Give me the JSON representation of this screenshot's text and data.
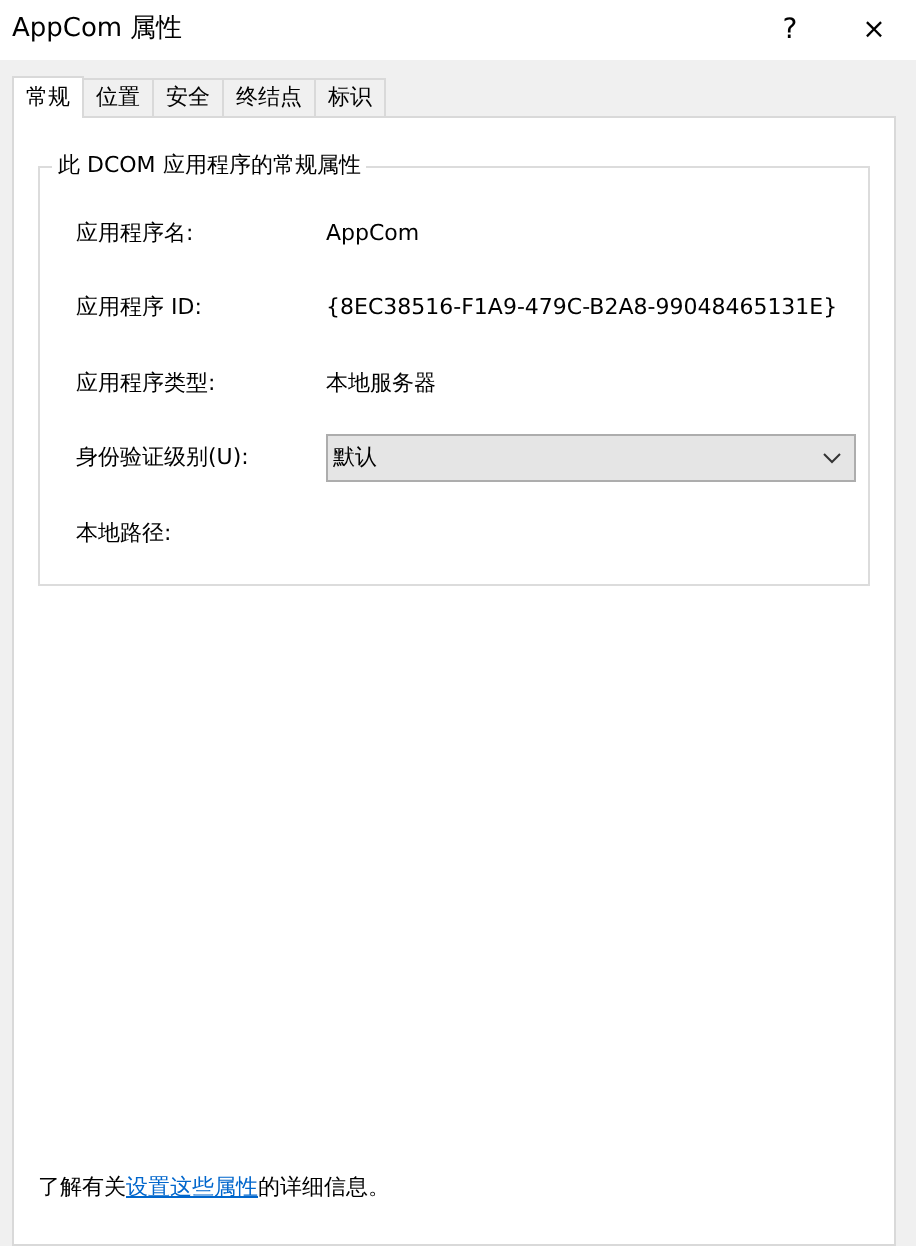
{
  "window": {
    "title": "AppCom 属性",
    "help": "?",
    "close": "×"
  },
  "tabs": [
    {
      "label": "常规",
      "selected": true
    },
    {
      "label": "位置",
      "selected": false
    },
    {
      "label": "安全",
      "selected": false
    },
    {
      "label": "终结点",
      "selected": false
    },
    {
      "label": "标识",
      "selected": false
    }
  ],
  "group": {
    "title": "此 DCOM 应用程序的常规属性",
    "fields": [
      {
        "kind": "text",
        "label": "应用程序名:",
        "value": "AppCom"
      },
      {
        "kind": "text",
        "label": "应用程序 ID:",
        "value": "{8EC38516-F1A9-479C-B2A8-99048465131E}"
      },
      {
        "kind": "text",
        "label": "应用程序类型:",
        "value": "本地服务器"
      },
      {
        "kind": "dropdown",
        "label": "身份验证级别(U):",
        "value": "默认"
      },
      {
        "kind": "text",
        "label": "本地路径:"
      }
    ]
  },
  "footer": {
    "before": "了解有关",
    "link": "设置这些属性",
    "after": "的详细信息。"
  }
}
